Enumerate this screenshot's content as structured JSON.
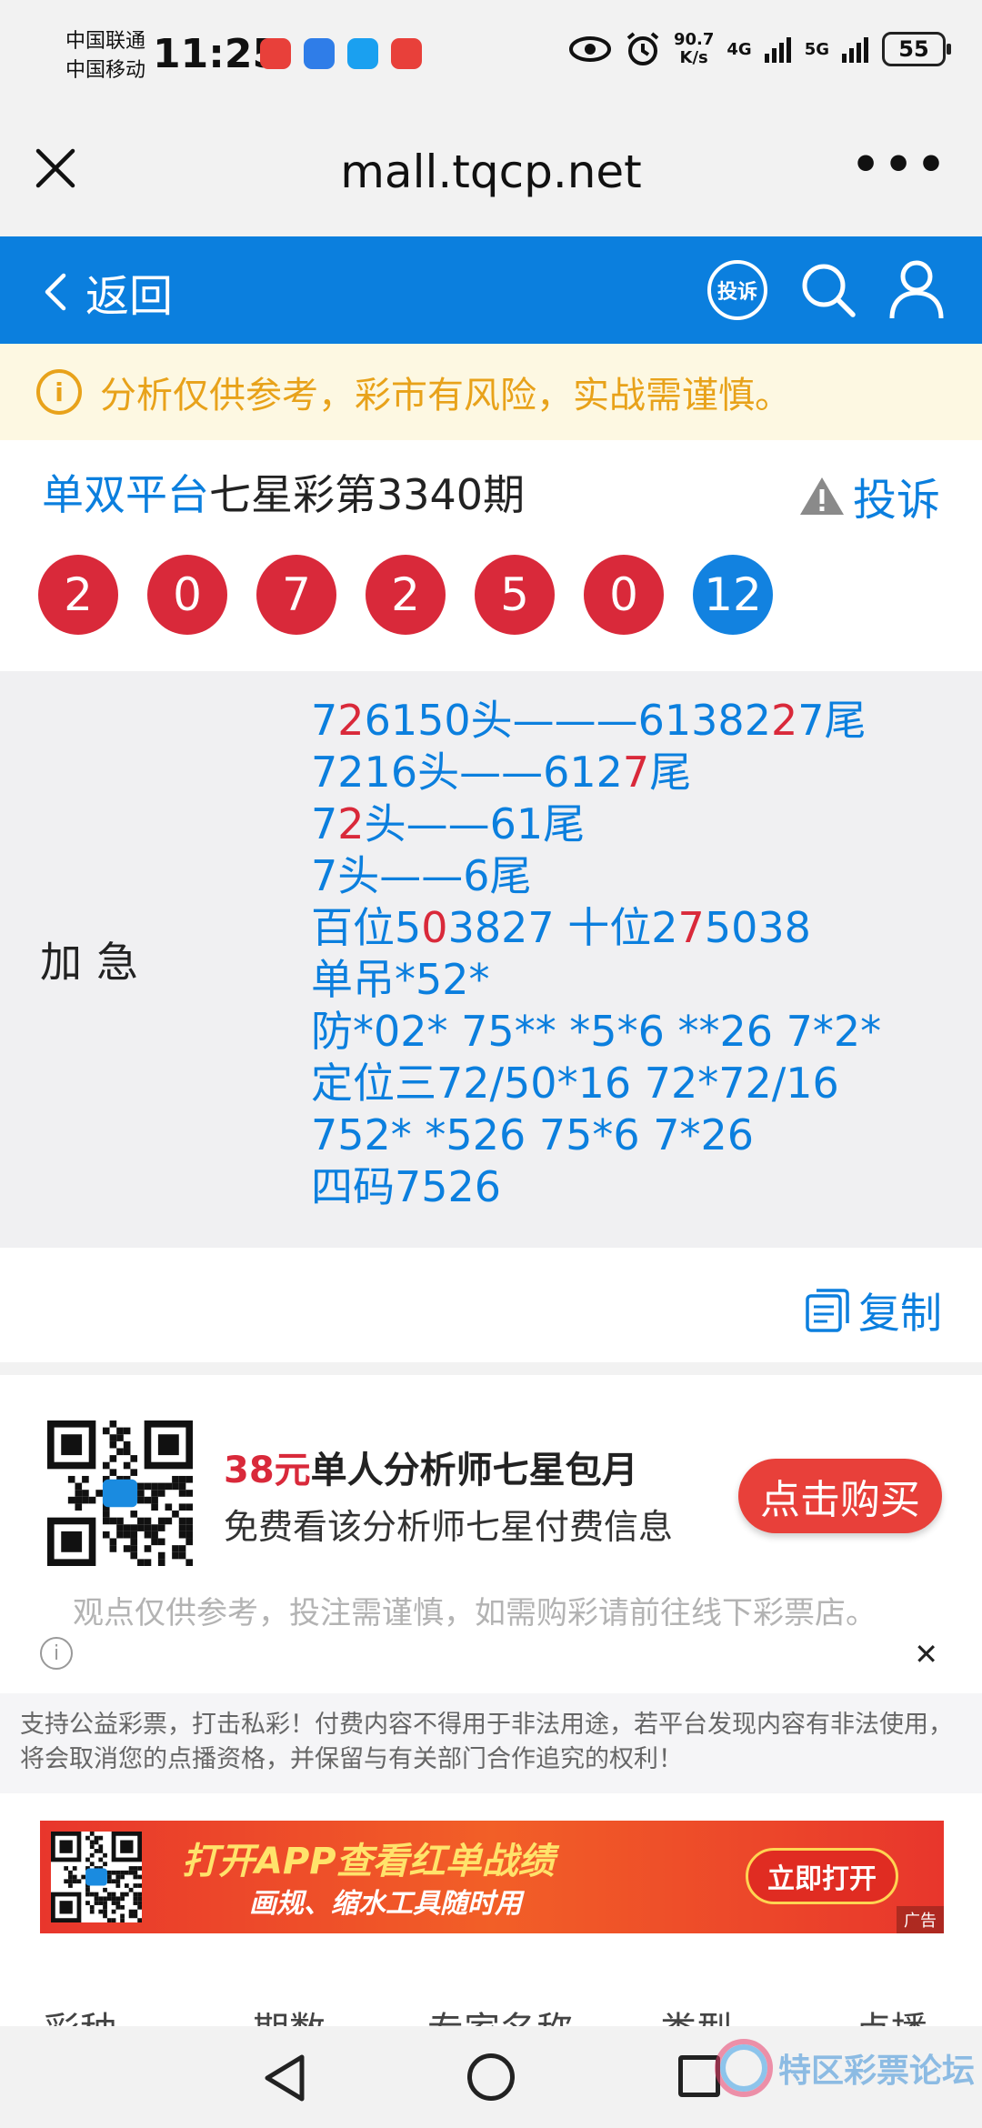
{
  "status_bar": {
    "carrier_1": "中国联通",
    "carrier_2": "中国移动",
    "time": "11:25",
    "net_speed_value": "90.7",
    "net_speed_unit": "K/s",
    "net_1": "4G",
    "net_2": "5G",
    "battery": "55"
  },
  "browser": {
    "url": "mall.tqcp.net",
    "more": "•••"
  },
  "header": {
    "back_label": "返回",
    "complaint_icon_label": "投诉"
  },
  "notice": {
    "text": "分析仅供参考，彩市有风险，实战需谨慎。"
  },
  "title": {
    "platform": "单双平台",
    "issue": "七星彩第3340期",
    "report_label": "投诉"
  },
  "balls": [
    "2",
    "0",
    "7",
    "2",
    "5",
    "0",
    "12"
  ],
  "analysis": {
    "label": "加急",
    "lines": [
      [
        [
          "7",
          0
        ],
        [
          "2",
          1
        ],
        [
          "6150头———61382",
          0
        ],
        [
          "2",
          1
        ],
        [
          "7尾",
          0
        ]
      ],
      [
        [
          "72",
          0
        ],
        [
          "1",
          0
        ],
        [
          "6头——612",
          0
        ],
        [
          "7",
          1
        ],
        [
          "尾",
          0
        ]
      ],
      [
        [
          "7",
          0
        ],
        [
          "2",
          1
        ],
        [
          "头——61尾",
          0
        ]
      ],
      [
        [
          "7头——6尾",
          0
        ]
      ],
      [
        [
          "百位5",
          0
        ],
        [
          "0",
          1
        ],
        [
          "3827 十位2",
          0
        ],
        [
          "7",
          1
        ],
        [
          "5038",
          0
        ]
      ],
      [
        [
          "单吊*52*",
          0
        ]
      ],
      [
        [
          "防*02* 75** *5*6 **26 7*2*",
          0
        ]
      ],
      [
        [
          "定位三72/50*16 72*72/16",
          0
        ]
      ],
      [
        [
          "752* *526 75*6 7*26",
          0
        ]
      ],
      [
        [
          "四码7526",
          0
        ]
      ]
    ]
  },
  "copy_label": "复制",
  "product": {
    "price": "38元",
    "title": "单人分析师七星包月",
    "subtitle": "免费看该分析师七星付费信息",
    "buy_label": "点击购买"
  },
  "disclaimer": "观点仅供参考，投注需谨慎，如需购彩请前往线下彩票店。",
  "legal": "支持公益彩票，打击私彩！付费内容不得用于非法用途，若平台发现内容有非法使用，将会取消您的点播资格，并保留与有关部门合作追究的权利！",
  "banner": {
    "line1": "打开APP查看红单战绩",
    "line2": "画规、缩水工具随时用",
    "button": "立即打开",
    "ad_tag": "广告"
  },
  "table_headers": [
    "彩种",
    "期数",
    "专家名称",
    "类型",
    "点播"
  ],
  "watermark": {
    "text": "特区彩票论坛"
  },
  "colors": {
    "brand_blue": "#0b7fde",
    "red": "#d9293a",
    "notice_orange": "#e8a21a"
  }
}
